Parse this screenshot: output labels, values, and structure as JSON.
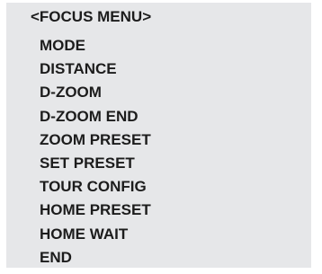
{
  "menu": {
    "title": "<FOCUS MENU>",
    "items": [
      {
        "label": "MODE"
      },
      {
        "label": "DISTANCE"
      },
      {
        "label": "D-ZOOM"
      },
      {
        "label": "D-ZOOM END"
      },
      {
        "label": "ZOOM PRESET"
      },
      {
        "label": "SET PRESET"
      },
      {
        "label": "TOUR CONFIG"
      },
      {
        "label": "HOME PRESET"
      },
      {
        "label": "HOME WAIT"
      },
      {
        "label": "END"
      }
    ]
  },
  "colors": {
    "panel_background": "#e6e7e9",
    "text": "#1c1c1c"
  }
}
